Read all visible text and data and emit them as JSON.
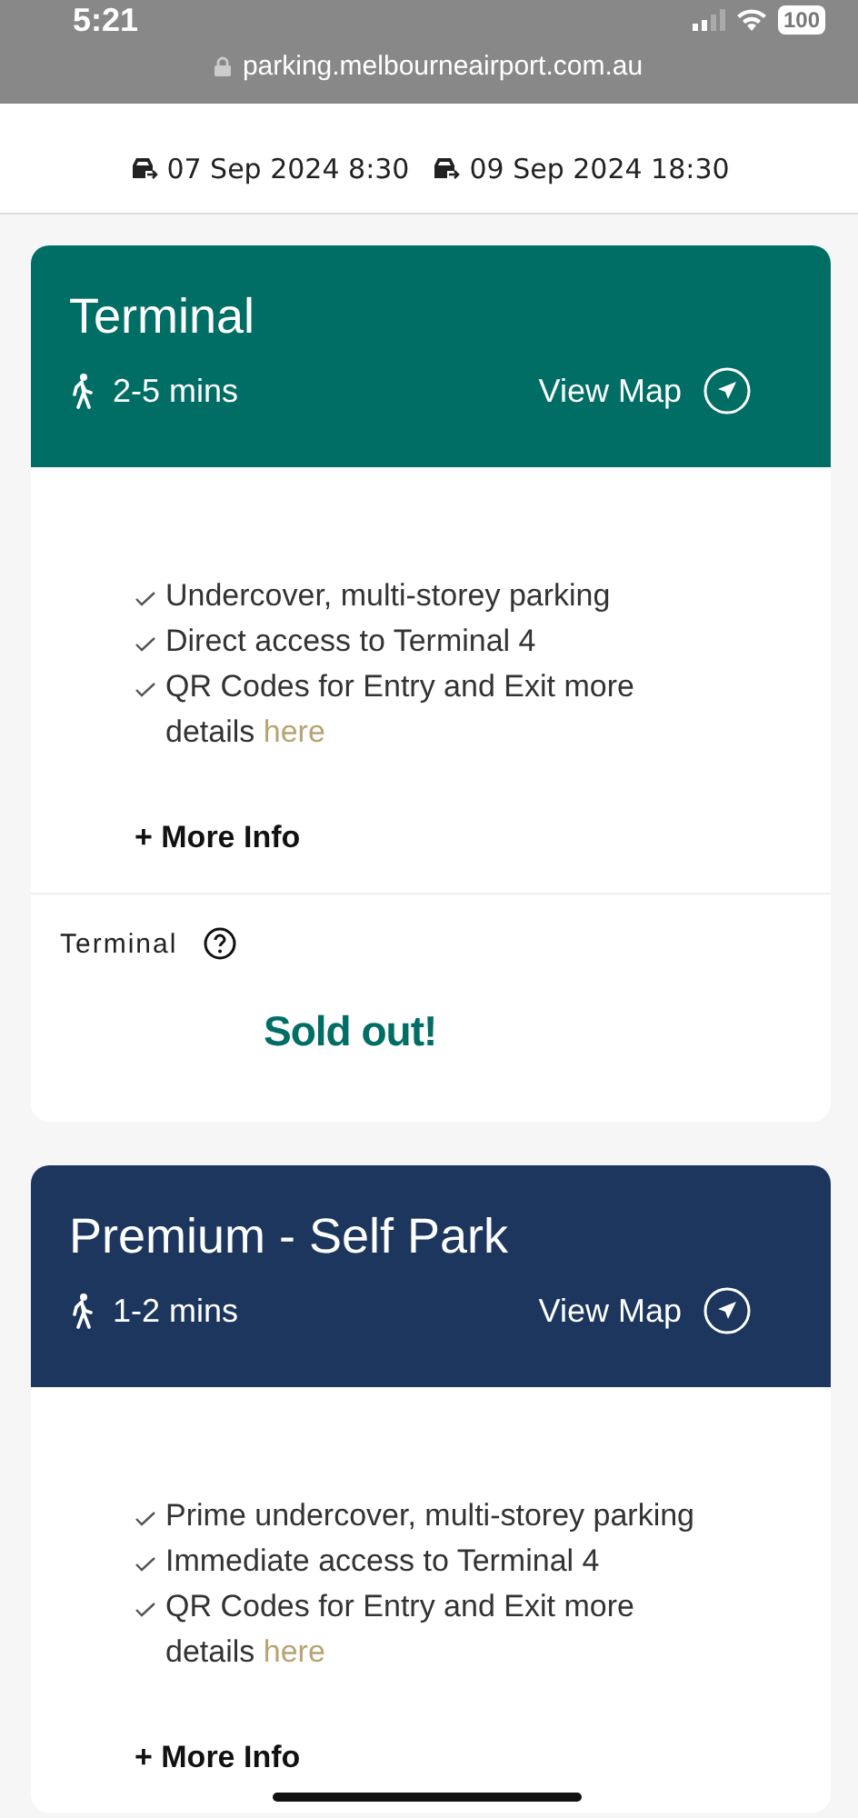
{
  "status_bar": {
    "time": "5:21",
    "battery": "100"
  },
  "browser": {
    "url": "parking.melbourneairport.com.au"
  },
  "dates": [
    {
      "text": "07 Sep 2024 8:30"
    },
    {
      "text": "09 Sep 2024 18:30"
    }
  ],
  "cards": [
    {
      "title": "Terminal",
      "color": "#016e66",
      "walk": "2-5 mins",
      "map_link": "View Map",
      "features": [
        {
          "text": "Undercover, multi-storey parking"
        },
        {
          "text": "Direct access to Terminal 4"
        },
        {
          "text": "QR Codes for Entry and Exit more details",
          "link": "here"
        }
      ],
      "more_info": "+ More Info",
      "product": {
        "label": "Terminal",
        "status": "Sold out!"
      }
    },
    {
      "title": "Premium - Self Park",
      "color": "#1c365d",
      "walk": "1-2 mins",
      "map_link": "View Map",
      "features": [
        {
          "text": "Prime undercover, multi-storey parking"
        },
        {
          "text": "Immediate access to Terminal 4"
        },
        {
          "text": "QR Codes for Entry and Exit more details",
          "link": "here"
        }
      ],
      "more_info": "+ More Info"
    }
  ]
}
